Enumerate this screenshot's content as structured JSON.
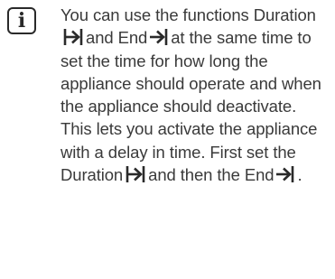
{
  "note": {
    "icon": "info-icon",
    "segments": [
      "You can use the functions Duration",
      "and End",
      "at the same time to set the time for how long the appliance should operate and when the appliance should deactivate. This lets you activate the appliance with a delay in time. First set the Duration",
      "and then the End",
      "."
    ],
    "symbols": {
      "duration": "duration-icon",
      "end": "end-time-icon"
    }
  }
}
